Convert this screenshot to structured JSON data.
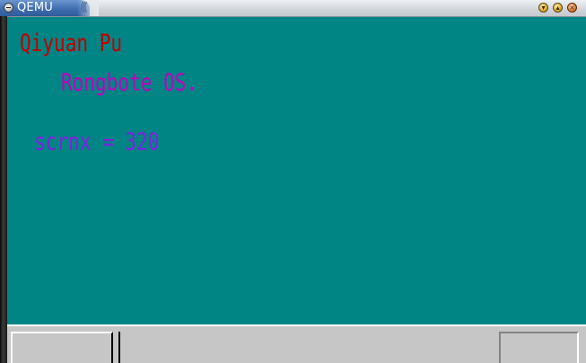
{
  "window": {
    "title": "QEMU",
    "title_decoration": "(((",
    "accent_color": "#3f6db0"
  },
  "screen": {
    "background_color": "#008484",
    "lines": [
      {
        "text": "Qiyuan Pu",
        "color": "#c00000"
      },
      {
        "text": "Rongbote OS.",
        "color": "#c000c0"
      },
      {
        "text": "scrnx = 320",
        "color": "#8020e0"
      }
    ]
  },
  "taskbar": {
    "background_color": "#c6c6c6",
    "start_button_label": "",
    "tray_label": ""
  },
  "icons": {
    "window_menu": "window-menu-icon",
    "minimize": "minimize-icon",
    "maximize": "maximize-icon",
    "close": "close-icon"
  }
}
